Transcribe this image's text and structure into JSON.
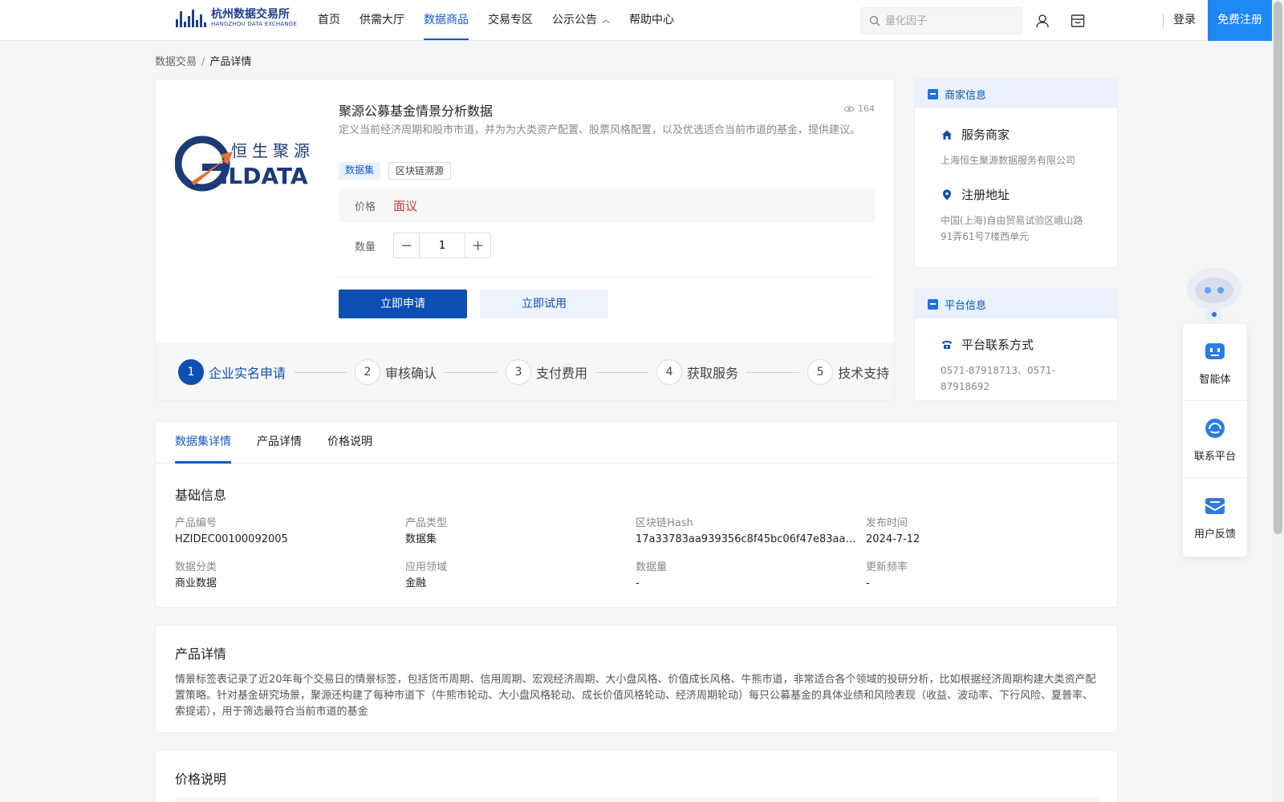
{
  "header": {
    "logo_cn": "杭州数据交易所",
    "logo_en": "HANGZHOU DATA EXCHANGE",
    "nav": [
      "首页",
      "供需大厅",
      "数据商品",
      "交易专区",
      "公示公告",
      "帮助中心"
    ],
    "search_placeholder": "量化因子",
    "login": "登录",
    "register": "免费注册"
  },
  "breadcrumb": {
    "parent": "数据交易",
    "separator": "/",
    "current": "产品详情"
  },
  "product": {
    "logo_text_cn": "恒生聚源",
    "logo_text_en": "GILDATA",
    "title": "聚源公募基金情景分析数据",
    "views": "164",
    "description": "定义当前经济周期和股市市道，并为为大类资产配置、股票风格配置，以及优选适合当前市道的基金，提供建议。",
    "tags": [
      "数据集",
      "区块链溯源"
    ],
    "price_label": "价格",
    "price_value": "面议",
    "qty_label": "数量",
    "qty_value": "1",
    "apply_button": "立即申请",
    "trial_button": "立即试用",
    "steps": [
      {
        "num": "1",
        "label": "企业实名申请"
      },
      {
        "num": "2",
        "label": "审核确认"
      },
      {
        "num": "3",
        "label": "支付费用"
      },
      {
        "num": "4",
        "label": "获取服务"
      },
      {
        "num": "5",
        "label": "技术支持"
      }
    ]
  },
  "merchant": {
    "header": "商家信息",
    "service_title": "服务商家",
    "service_value": "上海恒生聚源数据服务有限公司",
    "address_title": "注册地址",
    "address_line1": "中国(上海)自由贸易试验区峨山路",
    "address_line2": "91弄61号7楼西单元"
  },
  "platform": {
    "header": "平台信息",
    "contact_title": "平台联系方式",
    "contact_value": "0571-87918713、0571-87918692"
  },
  "tabs": [
    "数据集详情",
    "产品详情",
    "价格说明"
  ],
  "basic_info": {
    "title": "基础信息",
    "fields": [
      {
        "key": "产品编号",
        "value": "HZIDEC00100092005"
      },
      {
        "key": "产品类型",
        "value": "数据集"
      },
      {
        "key": "区块链Hash",
        "value": "17a33783aa939356c8f45bc06f47e83aa89…"
      },
      {
        "key": "发布时间",
        "value": "2024-7-12"
      },
      {
        "key": "数据分类",
        "value": "商业数据"
      },
      {
        "key": "应用领域",
        "value": "金融"
      },
      {
        "key": "数据量",
        "value": "-"
      },
      {
        "key": "更新频率",
        "value": "-"
      }
    ]
  },
  "product_detail": {
    "title": "产品详情",
    "text": "情景标签表记录了近20年每个交易日的情景标签，包括货币周期、信用周期、宏观经济周期、大小盘风格、价值成长风格、牛熊市道，非常适合各个领域的投研分析，比如根据经济周期构建大类资产配置策略。针对基金研究场景，聚源还构建了每种市道下（牛熊市轮动、大小盘风格轮动、成长价值风格轮动、经济周期轮动）每只公募基金的具体业绩和风险表现（收益、波动率、下行风险、夏普率、索提诺），用于筛选最符合当前市道的基金"
  },
  "price_desc": {
    "title": "价格说明"
  },
  "float_panel": {
    "items": [
      "智能体",
      "联系平台",
      "用户反馈"
    ]
  },
  "colors": {
    "primary": "#0d4fb3",
    "link": "#1559c7",
    "register_bg": "#1e88f5",
    "price": "#c0392b"
  }
}
